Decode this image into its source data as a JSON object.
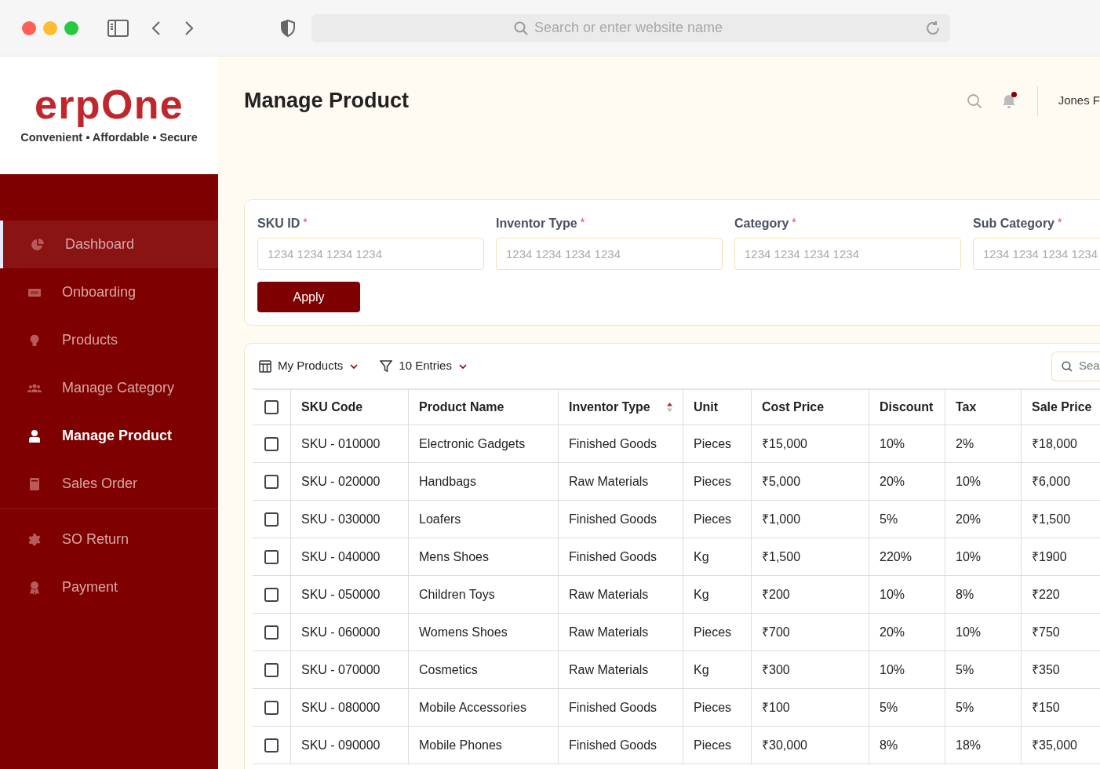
{
  "browser": {
    "address_placeholder": "Search or enter website name"
  },
  "logo": {
    "name": "erpOne",
    "tagline": "Convenient ▪ Affordable ▪ Secure"
  },
  "sidebar": {
    "items": [
      {
        "label": "Dashboard",
        "kind": "pie",
        "selected": false,
        "highlighted": true
      },
      {
        "label": "Onboarding",
        "kind": "ticket",
        "selected": false,
        "highlighted": false
      },
      {
        "label": "Products",
        "kind": "bulb",
        "selected": false,
        "highlighted": false
      },
      {
        "label": "Manage Category",
        "kind": "users",
        "selected": false,
        "highlighted": false
      },
      {
        "label": "Manage Product",
        "kind": "user",
        "selected": true,
        "highlighted": false
      },
      {
        "label": "Sales Order",
        "kind": "book",
        "selected": false,
        "highlighted": false
      },
      {
        "label": "SO Return",
        "kind": "gear",
        "selected": false,
        "highlighted": false,
        "divider_before": true
      },
      {
        "label": "Payment",
        "kind": "award",
        "selected": false,
        "highlighted": false
      }
    ]
  },
  "header": {
    "title": "Manage Product",
    "user": "Jones F",
    "has_notification": true
  },
  "filters": {
    "fields": [
      {
        "label": "SKU ID",
        "required_mark": "*",
        "placeholder": "1234 1234 1234 1234"
      },
      {
        "label": "Inventor Type",
        "required_mark": "*",
        "placeholder": "1234 1234 1234 1234"
      },
      {
        "label": "Category",
        "required_mark": "*",
        "placeholder": "1234 1234 1234 1234"
      },
      {
        "label": "Sub Category",
        "required_mark": "*",
        "placeholder": "1234 1234 1234 1234"
      }
    ],
    "apply": "Apply"
  },
  "toolbar": {
    "view": "My Products",
    "entries": "10 Entries",
    "search_placeholder": "Sea"
  },
  "table": {
    "all_checked": false,
    "columns": [
      {
        "label": "SKU Code",
        "sortable": false
      },
      {
        "label": "Product Name",
        "sortable": false
      },
      {
        "label": "Inventor Type",
        "sortable": true
      },
      {
        "label": "Unit",
        "sortable": false
      },
      {
        "label": "Cost Price",
        "sortable": false
      },
      {
        "label": "Discount",
        "sortable": false
      },
      {
        "label": "Tax",
        "sortable": false
      },
      {
        "label": "Sale Price",
        "sortable": false
      }
    ],
    "rows": [
      {
        "checked": false,
        "cells": [
          "SKU - 010000",
          "Electronic Gadgets",
          "Finished Goods",
          "Pieces",
          "₹15,000",
          "10%",
          "2%",
          "₹18,000"
        ]
      },
      {
        "checked": false,
        "cells": [
          "SKU - 020000",
          "Handbags",
          "Raw Materials",
          "Pieces",
          "₹5,000",
          "20%",
          "10%",
          "₹6,000"
        ]
      },
      {
        "checked": false,
        "cells": [
          "SKU - 030000",
          "Loafers",
          "Finished Goods",
          "Pieces",
          "₹1,000",
          "5%",
          "20%",
          "₹1,500"
        ]
      },
      {
        "checked": false,
        "cells": [
          "SKU - 040000",
          "Mens Shoes",
          "Finished Goods",
          "Kg",
          "₹1,500",
          "220%",
          "10%",
          "₹1900"
        ]
      },
      {
        "checked": false,
        "cells": [
          "SKU - 050000",
          "Children Toys",
          "Raw Materials",
          "Kg",
          "₹200",
          "10%",
          "8%",
          "₹220"
        ]
      },
      {
        "checked": false,
        "cells": [
          "SKU - 060000",
          "Womens Shoes",
          "Raw Materials",
          "Pieces",
          "₹700",
          "20%",
          "10%",
          "₹750"
        ]
      },
      {
        "checked": false,
        "cells": [
          "SKU - 070000",
          "Cosmetics",
          "Raw Materials",
          "Kg",
          "₹300",
          "10%",
          "5%",
          "₹350"
        ]
      },
      {
        "checked": false,
        "cells": [
          "SKU - 080000",
          "Mobile Accessories",
          "Finished Goods",
          "Pieces",
          "₹100",
          "5%",
          "5%",
          "₹150"
        ]
      },
      {
        "checked": false,
        "cells": [
          "SKU - 090000",
          "Mobile Phones",
          "Finished Goods",
          "Pieces",
          "₹30,000",
          "8%",
          "18%",
          "₹35,000"
        ]
      }
    ]
  }
}
